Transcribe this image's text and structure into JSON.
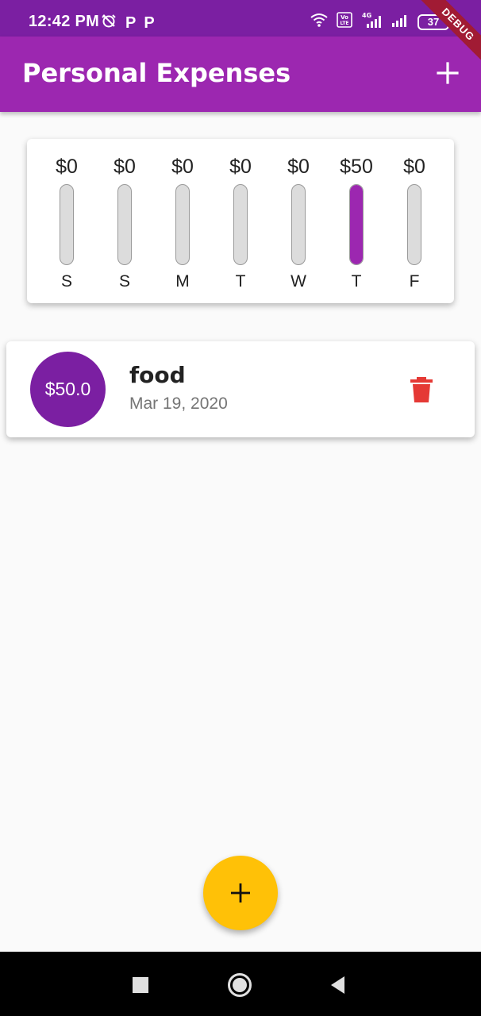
{
  "status_bar": {
    "time": "12:42 PM",
    "battery": "37",
    "icons_left": [
      "alarm-off-icon",
      "p-icon",
      "p-icon"
    ],
    "icons_right": [
      "wifi-icon",
      "volte-icon",
      "signal-4g-icon",
      "signal-icon",
      "battery-icon"
    ]
  },
  "debug_banner": "DEBUG",
  "app_bar": {
    "title": "Personal Expenses",
    "add_icon": "plus-icon"
  },
  "chart_data": {
    "type": "bar",
    "categories": [
      "S",
      "S",
      "M",
      "T",
      "W",
      "T",
      "F"
    ],
    "amount_labels": [
      "$0",
      "$0",
      "$0",
      "$0",
      "$0",
      "$50",
      "$0"
    ],
    "values": [
      0,
      0,
      0,
      0,
      0,
      50,
      0
    ],
    "total": 50,
    "colors": {
      "fill": "#9c27b0",
      "track": "#dcdcdc"
    }
  },
  "transactions": [
    {
      "amount": "$50.0",
      "title": "food",
      "date": "Mar 19, 2020",
      "delete_icon": "trash-icon"
    }
  ],
  "fab": {
    "icon": "plus-icon"
  },
  "nav": {
    "icons": [
      "square-icon",
      "home-circle-icon",
      "back-triangle-icon"
    ]
  },
  "colors": {
    "primary": "#9c27b0",
    "primary_dark": "#7b1fa2",
    "accent": "#ffc107",
    "delete": "#e53935"
  }
}
